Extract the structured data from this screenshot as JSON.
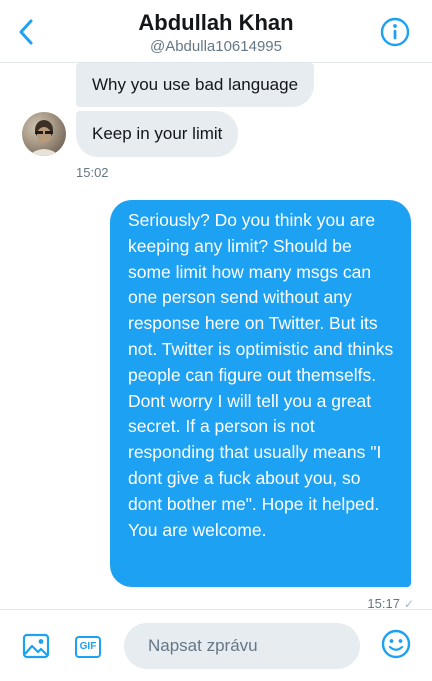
{
  "header": {
    "title": "Abdullah Khan",
    "handle": "@Abdulla10614995",
    "back_icon": "chevron-left-icon",
    "info_icon": "info-icon"
  },
  "messages": {
    "incoming": [
      {
        "text": "Why you use bad language"
      },
      {
        "text": "Keep in your limit"
      }
    ],
    "incoming_time": "15:02",
    "outgoing": {
      "text": "Seriously? Do you think you are keeping any limit? Should be some limit how many msgs can one person send without any response here on Twitter. But its not. Twitter is optimistic and thinks people can figure out themselfs. Dont worry I will tell you a great secret. If a person is not responding that usually means \"I dont give a fuck about you, so dont bother me\". Hope it helped. You are welcome.",
      "time": "15:17",
      "status": "✓"
    }
  },
  "composer": {
    "gif_label": "GIF",
    "placeholder": "Napsat zprávu",
    "value": ""
  },
  "colors": {
    "accent": "#1da1f2",
    "incoming_bubble": "#e6ecf0",
    "muted_text": "#657786"
  }
}
